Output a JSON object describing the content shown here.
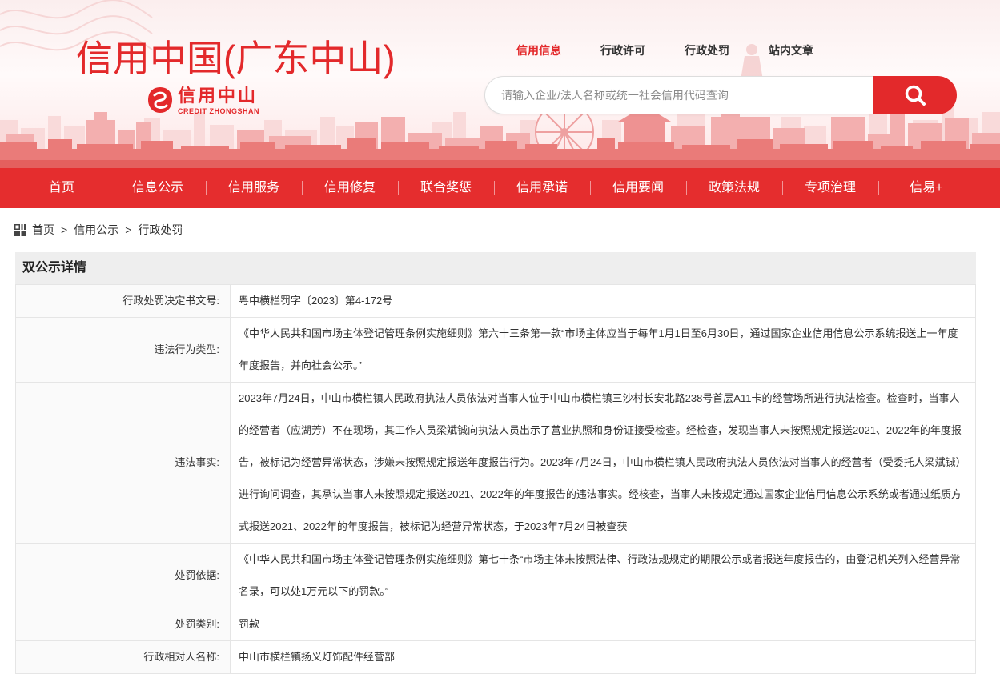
{
  "colors": {
    "brand_red": "#e3292b",
    "nav_red": "#e52d2e",
    "text_dark": "#333333",
    "border": "#e5e5e5"
  },
  "header": {
    "site_title": "信用中国(广东中山)",
    "logo": {
      "icon": "credit-zhongshan-emblem-icon",
      "name": "信用中山",
      "subtitle": "CREDIT ZHONGSHAN"
    },
    "top_links": [
      {
        "label": "信用信息",
        "active": true
      },
      {
        "label": "行政许可",
        "active": false
      },
      {
        "label": "行政处罚",
        "active": false
      },
      {
        "label": "站内文章",
        "active": false
      }
    ],
    "search": {
      "placeholder": "请输入企业/法人名称或统一社会信用代码查询",
      "value": "",
      "button_icon": "search-icon"
    }
  },
  "nav": {
    "items": [
      "首页",
      "信息公示",
      "信用服务",
      "信用修复",
      "联合奖惩",
      "信用承诺",
      "信用要闻",
      "政策法规",
      "专项治理",
      "信易+"
    ]
  },
  "breadcrumb": {
    "icon": "grid-icon",
    "separator": ">",
    "items": [
      "首页",
      "信用公示",
      "行政处罚"
    ]
  },
  "detail": {
    "title": "双公示详情",
    "rows": [
      {
        "label": "行政处罚决定书文号:",
        "value": "粤中横栏罚字〔2023〕第4-172号"
      },
      {
        "label": "违法行为类型:",
        "value": "《中华人民共和国市场主体登记管理条例实施细则》第六十三条第一款“市场主体应当于每年1月1日至6月30日，通过国家企业信用信息公示系统报送上一年度年度报告，并向社会公示。”"
      },
      {
        "label": "违法事实:",
        "value": "2023年7月24日，中山市横栏镇人民政府执法人员依法对当事人位于中山市横栏镇三沙村长安北路238号首层A11卡的经营场所进行执法检查。检查时，当事人的经营者（应湖芳）不在现场，其工作人员梁斌铖向执法人员出示了营业执照和身份证接受检查。经检查，发现当事人未按照规定报送2021、2022年的年度报告，被标记为经营异常状态，涉嫌未按照规定报送年度报告行为。2023年7月24日，中山市横栏镇人民政府执法人员依法对当事人的经营者（受委托人梁斌铖）进行询问调查，其承认当事人未按照规定报送2021、2022年的年度报告的违法事实。经核查，当事人未按规定通过国家企业信用信息公示系统或者通过纸质方式报送2021、2022年的年度报告，被标记为经营异常状态，于2023年7月24日被查获"
      },
      {
        "label": "处罚依据:",
        "value": "《中华人民共和国市场主体登记管理条例实施细则》第七十条“市场主体未按照法律、行政法规规定的期限公示或者报送年度报告的，由登记机关列入经营异常名录，可以处1万元以下的罚款。”"
      },
      {
        "label": "处罚类别:",
        "value": "罚款"
      },
      {
        "label": "行政相对人名称:",
        "value": "中山市横栏镇扬义灯饰配件经营部"
      }
    ]
  }
}
